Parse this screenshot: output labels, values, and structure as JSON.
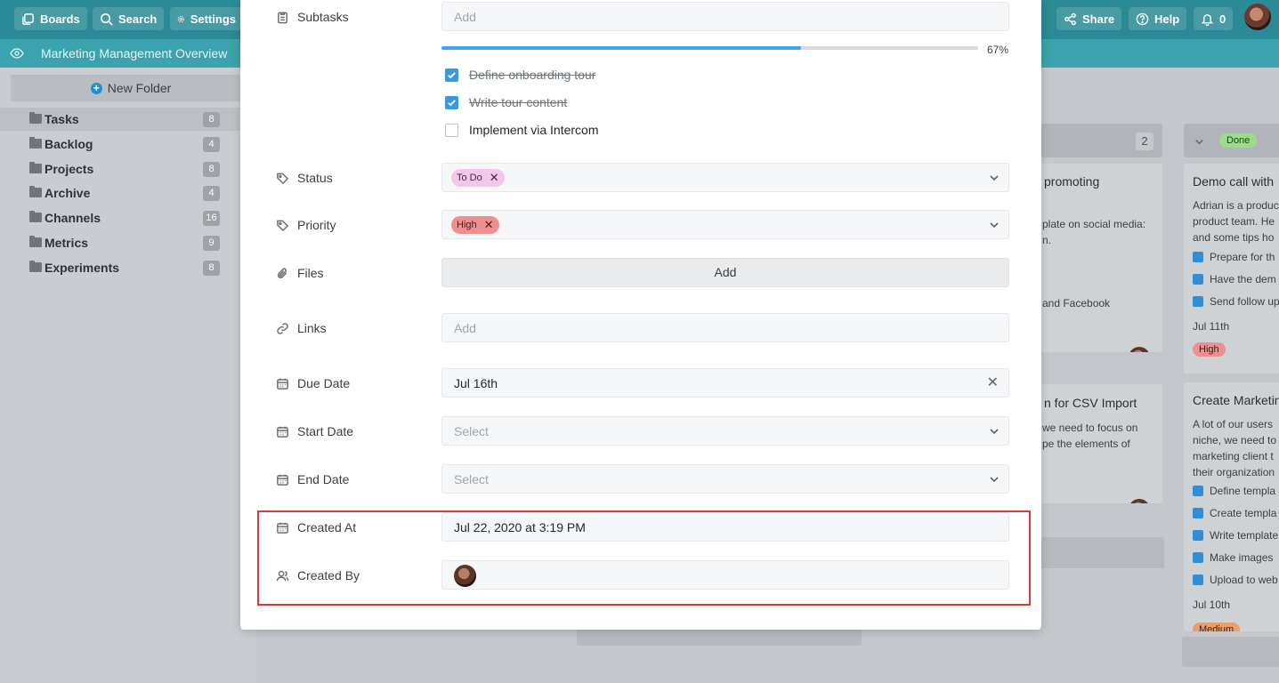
{
  "topbar": {
    "boards": "Boards",
    "search": "Search",
    "settings": "Settings",
    "share": "Share",
    "help": "Help",
    "notifications": "0"
  },
  "subbar": {
    "title": "Marketing Management Overview"
  },
  "sidebar": {
    "new_folder": "New Folder",
    "folders": [
      {
        "name": "Tasks",
        "count": "8"
      },
      {
        "name": "Backlog",
        "count": "4"
      },
      {
        "name": "Projects",
        "count": "8"
      },
      {
        "name": "Archive",
        "count": "4"
      },
      {
        "name": "Channels",
        "count": "16"
      },
      {
        "name": "Metrics",
        "count": "9"
      },
      {
        "name": "Experiments",
        "count": "8"
      }
    ]
  },
  "board": {
    "column_count": "2",
    "done_label": "Done",
    "cards": {
      "c1_title": "promoting",
      "c1_line1": "plate on social media:",
      "c1_line2": "n.",
      "c1_line3": "and Facebook",
      "c2_title": "n for CSV Import",
      "c2_line1": "we need to focus on",
      "c2_line2": "pe the elements of",
      "d1_title": "Demo call with",
      "d1_line1": "Adrian is a produc",
      "d1_line2": "product team. He",
      "d1_line3": "and some tips ho",
      "d1_check1": "Prepare for th",
      "d1_check2": "Have the dem",
      "d1_check3": "Send follow up",
      "d1_date": "Jul 11th",
      "d1_priority": "High",
      "d2_title": "Create Marketin",
      "d2_line1": "A lot of our users",
      "d2_line2": "niche, we need to",
      "d2_line3": "marketing client t",
      "d2_line4": "their organization",
      "d2_check1": "Define templa",
      "d2_check2": "Create templa",
      "d2_check3": "Write template",
      "d2_check4": "Make images",
      "d2_check5": "Upload to web",
      "d2_date": "Jul 10th",
      "d2_priority": "Medium"
    }
  },
  "modal": {
    "subtasks": {
      "label": "Subtasks",
      "placeholder": "Add",
      "progress": 0.67,
      "progress_label": "67%",
      "items": [
        {
          "text": "Define onboarding tour",
          "done": true
        },
        {
          "text": "Write tour content",
          "done": true
        },
        {
          "text": "Implement via Intercom",
          "done": false
        }
      ]
    },
    "status": {
      "label": "Status",
      "value": "To Do"
    },
    "priority": {
      "label": "Priority",
      "value": "High"
    },
    "files": {
      "label": "Files",
      "button": "Add"
    },
    "links": {
      "label": "Links",
      "placeholder": "Add"
    },
    "due_date": {
      "label": "Due Date",
      "value": "Jul 16th"
    },
    "start_date": {
      "label": "Start Date",
      "placeholder": "Select"
    },
    "end_date": {
      "label": "End Date",
      "placeholder": "Select"
    },
    "created_at": {
      "label": "Created At",
      "value": "Jul 22, 2020 at 3:19 PM"
    },
    "created_by": {
      "label": "Created By"
    }
  },
  "colors": {
    "topbar": "#2a8a96",
    "accent_blue": "#3ea6ef",
    "status_tag": "#f4c6ec",
    "priority_tag": "#ef8f8f",
    "done_tag": "#9bdc8a",
    "highlight": "#d93a3a"
  }
}
